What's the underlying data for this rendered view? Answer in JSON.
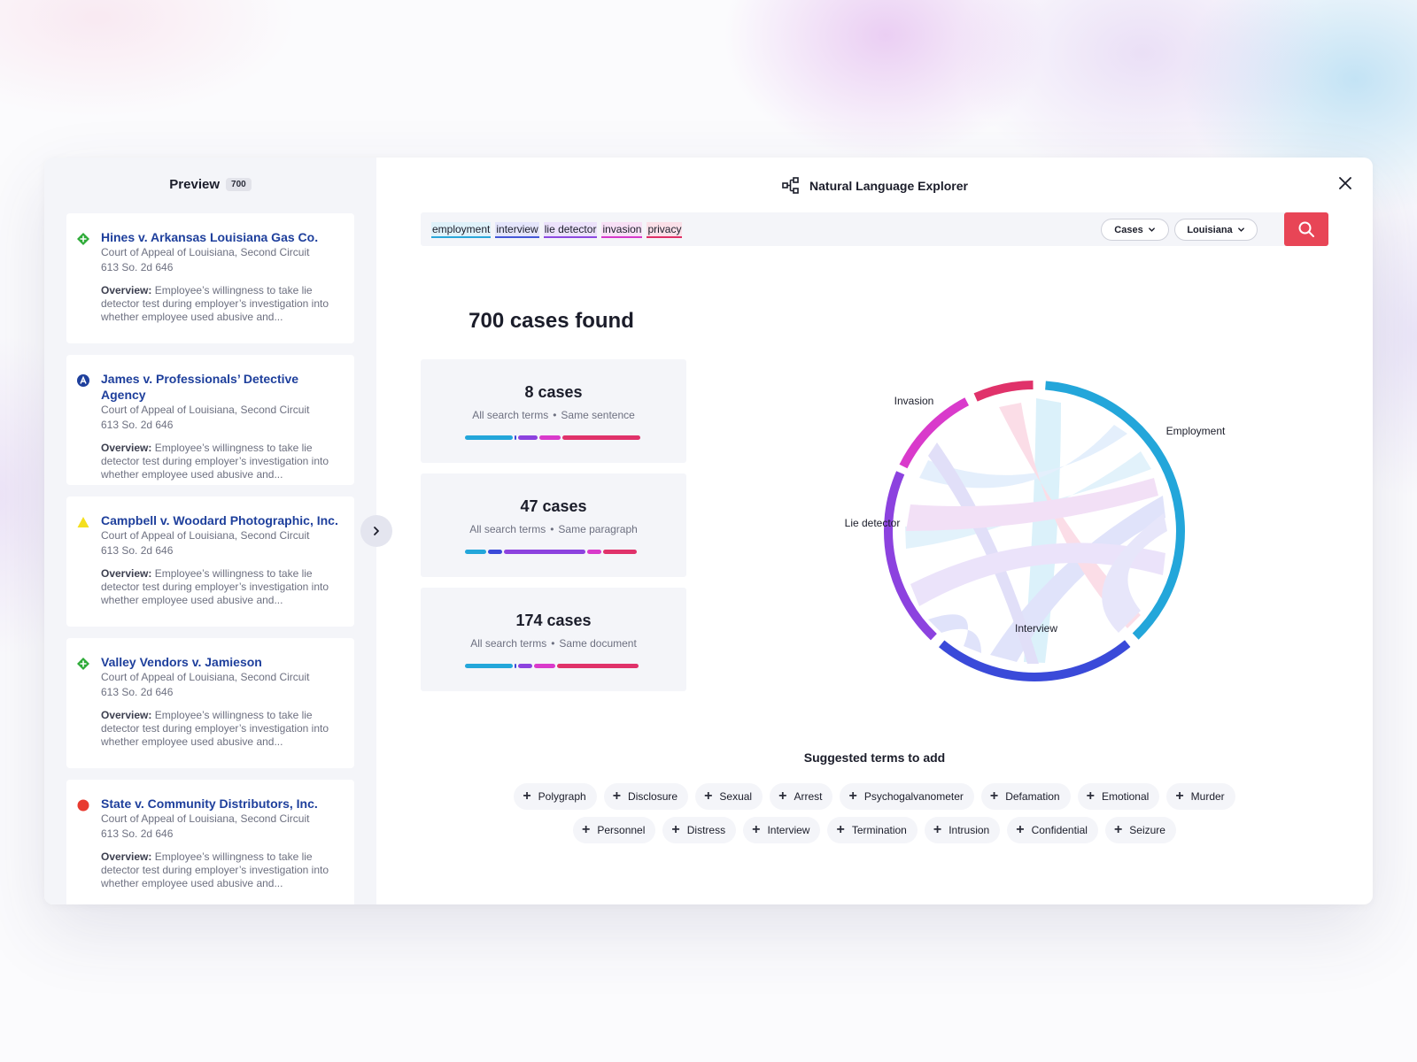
{
  "preview": {
    "title": "Preview",
    "count": "700"
  },
  "cases": [
    {
      "title": "Hines v. Arkansas Louisiana Gas Co.",
      "court": "Court of Appeal of Louisiana, Second Circuit",
      "citation": "613 So. 2d 646",
      "overview_label": "Overview:",
      "overview": "Employee’s willingness to take lie detector test during employer’s investigation into whether employee used abusive and...",
      "icon": "green-diamond-icon",
      "color": "#2eab38"
    },
    {
      "title": "James v. Professionals’ Detective Agency",
      "court": "Court of Appeal of Louisiana, Second Circuit",
      "citation": "613 So. 2d 646",
      "overview_label": "Overview:",
      "overview": "Employee’s willingness to take lie detector test during employer’s investigation into whether employee used abusive and...",
      "icon": "blue-a-circle-icon",
      "color": "#1e3f9c"
    },
    {
      "title": "Campbell v. Woodard Photographic, Inc.",
      "court": "Court of Appeal of Louisiana, Second Circuit",
      "citation": "613 So. 2d 646",
      "overview_label": "Overview:",
      "overview": "Employee’s willingness to take lie detector test during employer’s investigation into whether employee used abusive and...",
      "icon": "yellow-triangle-icon",
      "color": "#f4df1e"
    },
    {
      "title": "Valley Vendors v. Jamieson",
      "court": "Court of Appeal of Louisiana, Second Circuit",
      "citation": "613 So. 2d 646",
      "overview_label": "Overview:",
      "overview": "Employee’s willingness to take lie detector test during employer’s investigation into whether employee used abusive and...",
      "icon": "green-diamond-icon",
      "color": "#2eab38"
    },
    {
      "title": "State v. Community Distributors, Inc.",
      "court": "Court of Appeal of Louisiana, Second Circuit",
      "citation": "613 So. 2d 646",
      "overview_label": "Overview:",
      "overview": "Employee’s willingness to take lie detector test during employer’s investigation into whether employee used abusive and...",
      "icon": "red-circle-icon",
      "color": "#e83a2f"
    }
  ],
  "header": {
    "title": "Natural Language Explorer"
  },
  "search": {
    "terms": [
      "employment",
      "interview",
      "lie detector",
      "invasion",
      "privacy"
    ],
    "filter_type": "Cases",
    "filter_jurisdiction": "Louisiana"
  },
  "results": {
    "found_label": "700 cases found",
    "stats": [
      {
        "count": "8 cases",
        "scope": "All search terms",
        "level": "Same sentence",
        "bars": [
          0.28,
          0.02,
          0.12,
          0.13,
          0.45
        ]
      },
      {
        "count": "47 cases",
        "scope": "All search terms",
        "level": "Same paragraph",
        "bars": [
          0.13,
          0.09,
          0.47,
          0.09,
          0.2
        ]
      },
      {
        "count": "174 cases",
        "scope": "All search terms",
        "level": "Same document",
        "bars": [
          0.28,
          0.02,
          0.09,
          0.13,
          0.47
        ]
      }
    ]
  },
  "colors": {
    "employment": "#23a6da",
    "interview": "#3a4ad9",
    "lie_detector": "#8c42df",
    "invasion": "#d93acb",
    "privacy": "#e0326a",
    "accent": "#e84556"
  },
  "suggested": {
    "title": "Suggested terms to add",
    "row1": [
      "Polygraph",
      "Disclosure",
      "Sexual",
      "Arrest",
      "Psychogalvanometer",
      "Defamation",
      "Emotional",
      "Murder"
    ],
    "row2": [
      "Personnel",
      "Distress",
      "Interview",
      "Termination",
      "Intrusion",
      "Confidential",
      "Seizure"
    ]
  }
}
